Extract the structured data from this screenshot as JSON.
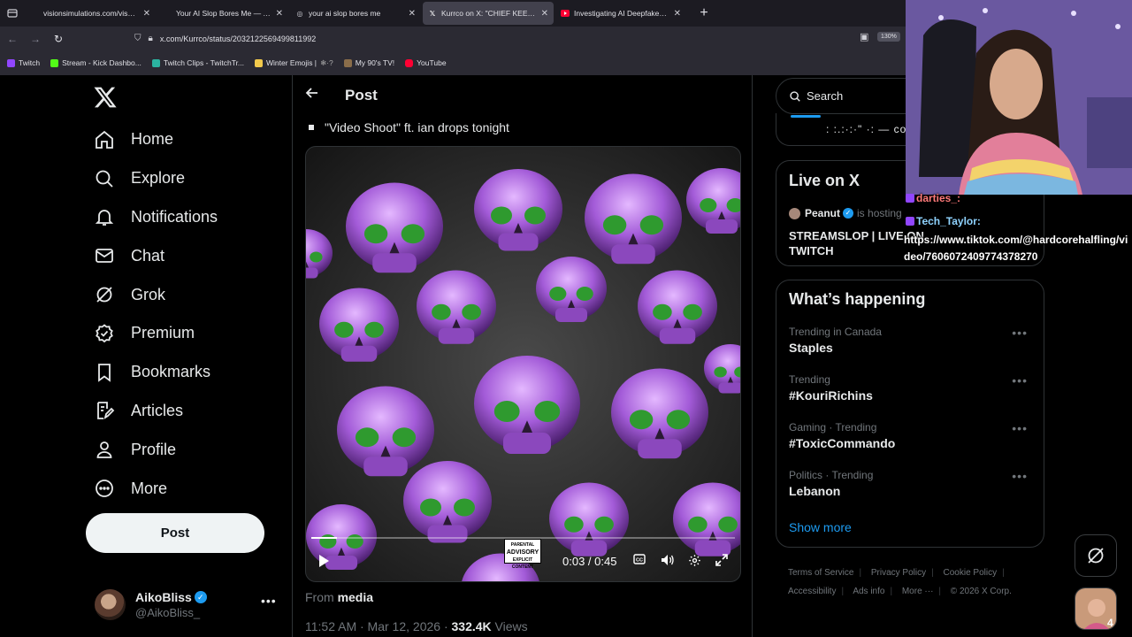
{
  "browser": {
    "tabs": [
      {
        "title": "visionsimulations.com/visual-snow.h",
        "icon": "page-icon",
        "active": false
      },
      {
        "title": "Your AI Slop Bores Me — The W",
        "icon": "page-icon",
        "active": false
      },
      {
        "title": "your ai slop bores me",
        "icon": "globe-icon",
        "active": false
      },
      {
        "title": "Kurrco on X: \"CHIEF KEEF SKELE",
        "icon": "x-logo-icon",
        "active": true
      },
      {
        "title": "Investigating AI Deepfakes - Yo",
        "icon": "youtube-icon",
        "active": false
      }
    ],
    "url": "x.com/Kurrco/status/2032122569499811992",
    "zoom": "130%",
    "bookmarks": [
      {
        "label": "Twitch",
        "color": "#9146ff"
      },
      {
        "label": "Stream - Kick Dashbo...",
        "color": "#53fc18"
      },
      {
        "label": "Twitch Clips - TwitchTr...",
        "color": "#2bb3a0"
      },
      {
        "label": "Winter Emojis |",
        "color": "#f2c94c"
      },
      {
        "label": "My 90's TV!",
        "color": "#8a6d4a"
      },
      {
        "label": "YouTube",
        "color": "#ff0033"
      }
    ]
  },
  "nav": {
    "items": [
      {
        "label": "Home",
        "icon": "home-icon"
      },
      {
        "label": "Explore",
        "icon": "search-icon"
      },
      {
        "label": "Notifications",
        "icon": "bell-icon"
      },
      {
        "label": "Chat",
        "icon": "mail-icon"
      },
      {
        "label": "Grok",
        "icon": "grok-icon"
      },
      {
        "label": "Premium",
        "icon": "premium-icon"
      },
      {
        "label": "Bookmarks",
        "icon": "bookmark-icon"
      },
      {
        "label": "Articles",
        "icon": "articles-icon"
      },
      {
        "label": "Profile",
        "icon": "profile-icon"
      },
      {
        "label": "More",
        "icon": "more-circle-icon"
      }
    ],
    "post_label": "Post",
    "account": {
      "name": "AikoBliss",
      "handle": "@AikoBliss_"
    }
  },
  "main": {
    "header_title": "Post",
    "tweet_text": "\"Video Shoot\" ft. ian drops tonight",
    "video": {
      "time": "0:03 / 0:45",
      "progress": 0.06,
      "advisory_line1": "PARENTAL",
      "advisory_line2": "ADVISORY",
      "advisory_line3": "EXPLICIT CONTENT"
    },
    "from_prefix": "From",
    "from_source": "media",
    "timestamp": "11:52 AM · Mar 12, 2026 ·",
    "views_count": "332.4K",
    "views_label": "Views"
  },
  "right": {
    "search_placeholder": "Search",
    "top_card_text": ": :.:·:·\" ·: — co",
    "live": {
      "title": "Live on X",
      "host_name": "Peanut",
      "host_suffix": "is hosting",
      "stream_title": "STREAMSLOP | LIVE ON TWITCH"
    },
    "happening": {
      "title": "What’s happening",
      "trends": [
        {
          "context": "Trending in Canada",
          "name": "Staples"
        },
        {
          "context": "Trending",
          "name": "#KouriRichins"
        },
        {
          "context": "Gaming · Trending",
          "name": "#ToxicCommando"
        },
        {
          "context": "Politics · Trending",
          "name": "Lebanon"
        }
      ],
      "show_more": "Show more"
    },
    "footer": [
      "Terms of Service",
      "Privacy Policy",
      "Cookie Policy",
      "Accessibility",
      "Ads info",
      "More ···",
      "© 2026 X Corp."
    ]
  },
  "overlay": {
    "chat1_user": "darties_:",
    "chat2_user": "Tech_Taylor:",
    "chat_url": "https://www.tiktok.com/@hardcorehalfling/video/7606072409774378270",
    "msg_count": "4"
  },
  "colors": {
    "accent": "#1d9bf0",
    "skull_purple": "#a35bd8",
    "skull_eye_green": "#2f9a2f"
  }
}
